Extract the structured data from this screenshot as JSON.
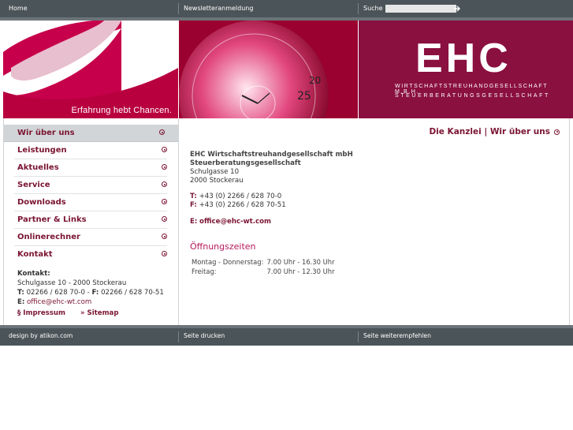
{
  "topbar": {
    "home": "Home",
    "newsletter": "Newsletteranmeldung",
    "search_label": "Suche",
    "search_value": ""
  },
  "banner": {
    "tagline": "Erfahrung hebt Chancen.",
    "logo": "EHC",
    "logo_line1": "WIRTSCHAFTSTREUHANDGESELLSCHAFT M.B.H.",
    "logo_line2": "STEUERBERATUNGSGESELLSCHAFT"
  },
  "nav": {
    "items": [
      {
        "label": "Wir über uns",
        "active": true
      },
      {
        "label": "Leistungen"
      },
      {
        "label": "Aktuelles"
      },
      {
        "label": "Service"
      },
      {
        "label": "Downloads"
      },
      {
        "label": "Partner & Links"
      },
      {
        "label": "Onlinerechner"
      },
      {
        "label": "Kontakt"
      }
    ]
  },
  "sidebar_contact": {
    "heading": "Kontakt:",
    "address": "Schulgasse 10 - 2000 Stockerau",
    "t_label": "T:",
    "t_value": "02266 / 628 70-0 -",
    "f_label": "F:",
    "f_value": "02266 / 628 70-51",
    "e_label": "E:",
    "e_value": "office@ehc-wt.com"
  },
  "sidebar_links": {
    "impressum": "§ Impressum",
    "sitemap": "» Sitemap"
  },
  "breadcrumb": "Die Kanzlei | Wir über uns",
  "main": {
    "company1": "EHC Wirtschaftstreuhandgesellschaft mbH",
    "company2": "Steuerberatungsgesellschaft",
    "street": "Schulgasse 10",
    "city": "2000 Stockerau",
    "t_label": "T:",
    "t_value": "+43 (0) 2266 / 628 70-0",
    "f_label": "F:",
    "f_value": "+43 (0) 2266 / 628 70-51",
    "e_label": "E:",
    "e_value": "office@ehc-wt.com",
    "hours_title": "Öffnungszeiten",
    "hours": [
      {
        "day": "Montag - Donnerstag:",
        "time": "7.00 Uhr - 16.30 Uhr"
      },
      {
        "day": "Freitag:",
        "time": "7.00 Uhr - 12.30 Uhr"
      }
    ]
  },
  "bottombar": {
    "design": "design by atikon.com",
    "print": "Seite drucken",
    "recommend": "Seite weiterempfehlen"
  },
  "colors": {
    "brand": "#7a1432",
    "bar": "#4b5458",
    "accent": "#b5185a"
  }
}
